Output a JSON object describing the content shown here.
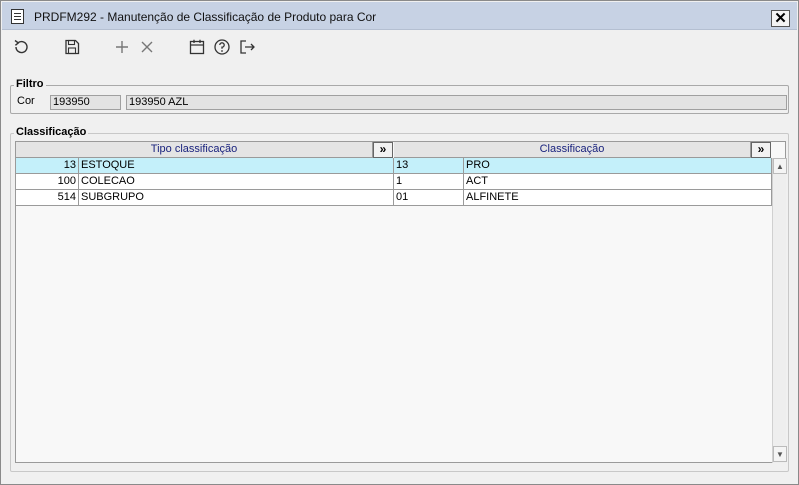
{
  "window": {
    "title": "PRDFM292 - Manutenção de Classificação de Produto para Cor",
    "close_symbol": "✕"
  },
  "toolbar": {
    "buttons": [
      {
        "icon": "refresh-icon"
      },
      {
        "icon": "save-icon"
      },
      {
        "icon": "add-icon"
      },
      {
        "icon": "delete-icon"
      },
      {
        "icon": "calendar-icon"
      },
      {
        "icon": "help-icon"
      },
      {
        "icon": "exit-icon"
      }
    ]
  },
  "filtro": {
    "legend": "Filtro",
    "cor_label": "Cor",
    "cor_code": "193950",
    "cor_description": "193950 AZL"
  },
  "classificacao": {
    "legend": "Classificação",
    "columns": {
      "tipo": "Tipo classificação",
      "classificacao": "Classificação",
      "expand_symbol": "»"
    },
    "rows": [
      {
        "tipo_code": "13",
        "tipo_name": "ESTOQUE",
        "class_code": "13",
        "class_name": "PRO",
        "selected": true
      },
      {
        "tipo_code": "100",
        "tipo_name": "COLECAO",
        "class_code": "1",
        "class_name": "ACT",
        "selected": false
      },
      {
        "tipo_code": "514",
        "tipo_name": "SUBGRUPO",
        "class_code": "01",
        "class_name": "ALFINETE",
        "selected": false
      }
    ],
    "scroll_up": "▲",
    "scroll_down": "▼"
  }
}
